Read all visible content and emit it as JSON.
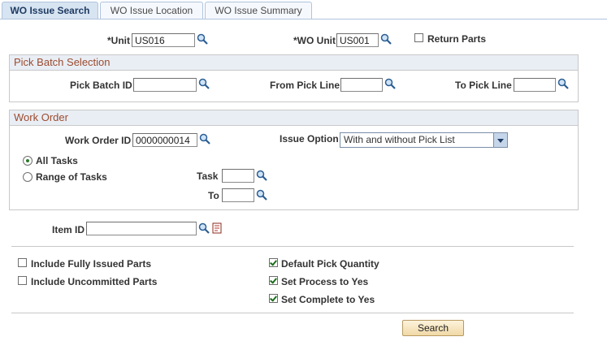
{
  "tabs": [
    {
      "label": "WO Issue Search",
      "active": true
    },
    {
      "label": "WO Issue Location",
      "active": false
    },
    {
      "label": "WO Issue Summary",
      "active": false
    }
  ],
  "header": {
    "unit_label": "*Unit",
    "unit_value": "US016",
    "wo_unit_label": "*WO Unit",
    "wo_unit_value": "US001",
    "return_parts_label": "Return Parts",
    "return_parts_checked": false
  },
  "pick_batch": {
    "title": "Pick Batch Selection",
    "pick_batch_id_label": "Pick Batch ID",
    "pick_batch_id_value": "",
    "from_pick_line_label": "From Pick Line",
    "from_pick_line_value": "",
    "to_pick_line_label": "To Pick Line",
    "to_pick_line_value": ""
  },
  "work_order": {
    "title": "Work Order",
    "work_order_id_label": "Work Order ID",
    "work_order_id_value": "0000000014",
    "issue_option_label": "Issue Option",
    "issue_option_value": "With and without Pick List",
    "all_tasks_label": "All Tasks",
    "range_of_tasks_label": "Range of Tasks",
    "selected_task_mode": "All Tasks",
    "task_label": "Task",
    "task_value": "",
    "to_label": "To",
    "to_value": ""
  },
  "item": {
    "item_id_label": "Item ID",
    "item_id_value": ""
  },
  "options": {
    "include_fully_issued": {
      "label": "Include Fully Issued Parts",
      "checked": false
    },
    "include_uncommitted": {
      "label": "Include Uncommitted Parts",
      "checked": false
    },
    "default_pick_quantity": {
      "label": "Default Pick Quantity",
      "checked": true
    },
    "set_process_to_yes": {
      "label": "Set Process to Yes",
      "checked": true
    },
    "set_complete_to_yes": {
      "label": "Set Complete to Yes",
      "checked": true
    }
  },
  "search_button_label": "Search",
  "icons": {
    "lookup": "magnifier-icon",
    "item_detail": "document-detail-icon"
  }
}
